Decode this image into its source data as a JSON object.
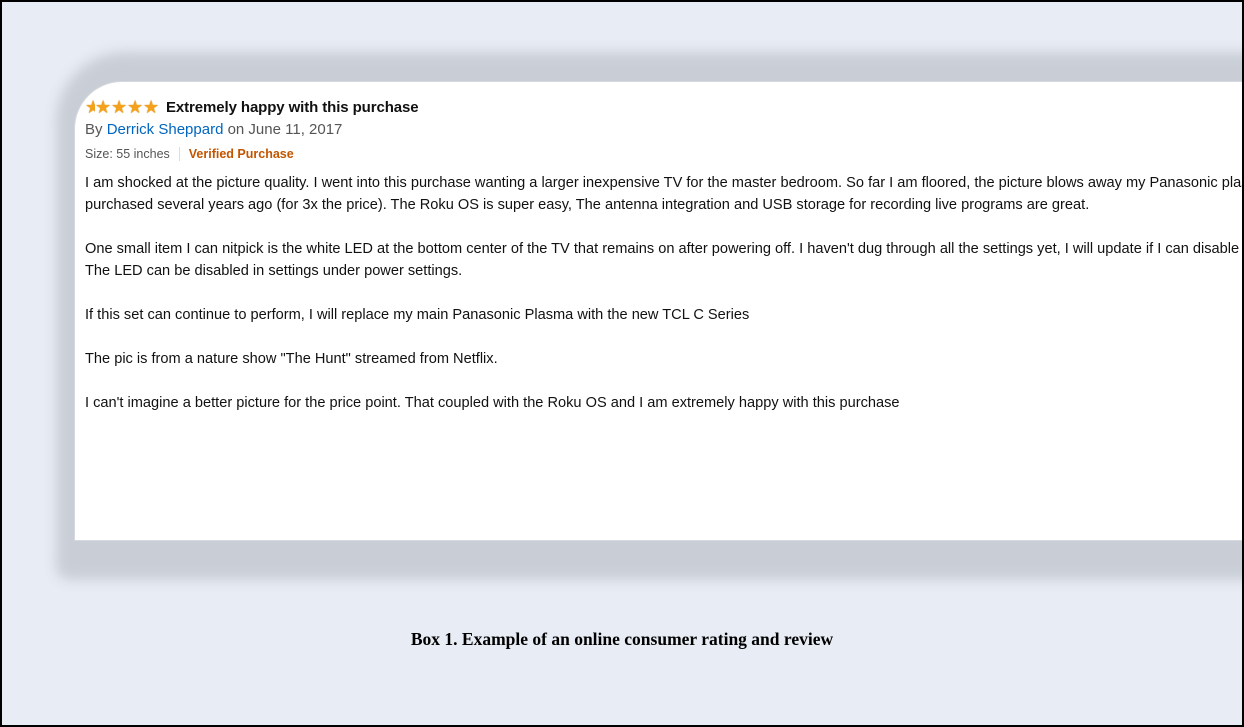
{
  "review": {
    "stars": 5,
    "star_icon": "★",
    "title": "Extremely happy with this purchase",
    "by_prefix": "By",
    "author": "Derrick Sheppard",
    "date": "on June 11, 2017",
    "size": "Size: 55 inches",
    "verified": "Verified Purchase",
    "paragraphs": [
      "I am shocked at the picture quality. I went into this purchase wanting a larger inexpensive TV for the master bedroom. So far I am floored, the picture blows away my Panasonic plasma I purchased several years ago (for 3x the price). The Roku OS is super easy, The antenna integration and USB storage for recording live programs are great.",
      "One small item I can nitpick is the white LED at the bottom center of the TV that remains on after powering off. I haven't dug through all the settings yet, I will update if I can disable it. Update: The LED can be disabled in settings under power settings.",
      "If this set can continue to perform, I will replace my main Panasonic Plasma with the new TCL C Series",
      "The pic is from a nature show \"The Hunt\" streamed from Netflix.",
      "I can't imagine a better picture for the price point. That coupled with the Roku OS and I am extremely happy with this purchase"
    ],
    "colors": {
      "star": "#f4a21b",
      "author_link": "#0066c0",
      "verified": "#c45500"
    }
  },
  "caption": "Box 1. Example of an online consumer rating and review"
}
